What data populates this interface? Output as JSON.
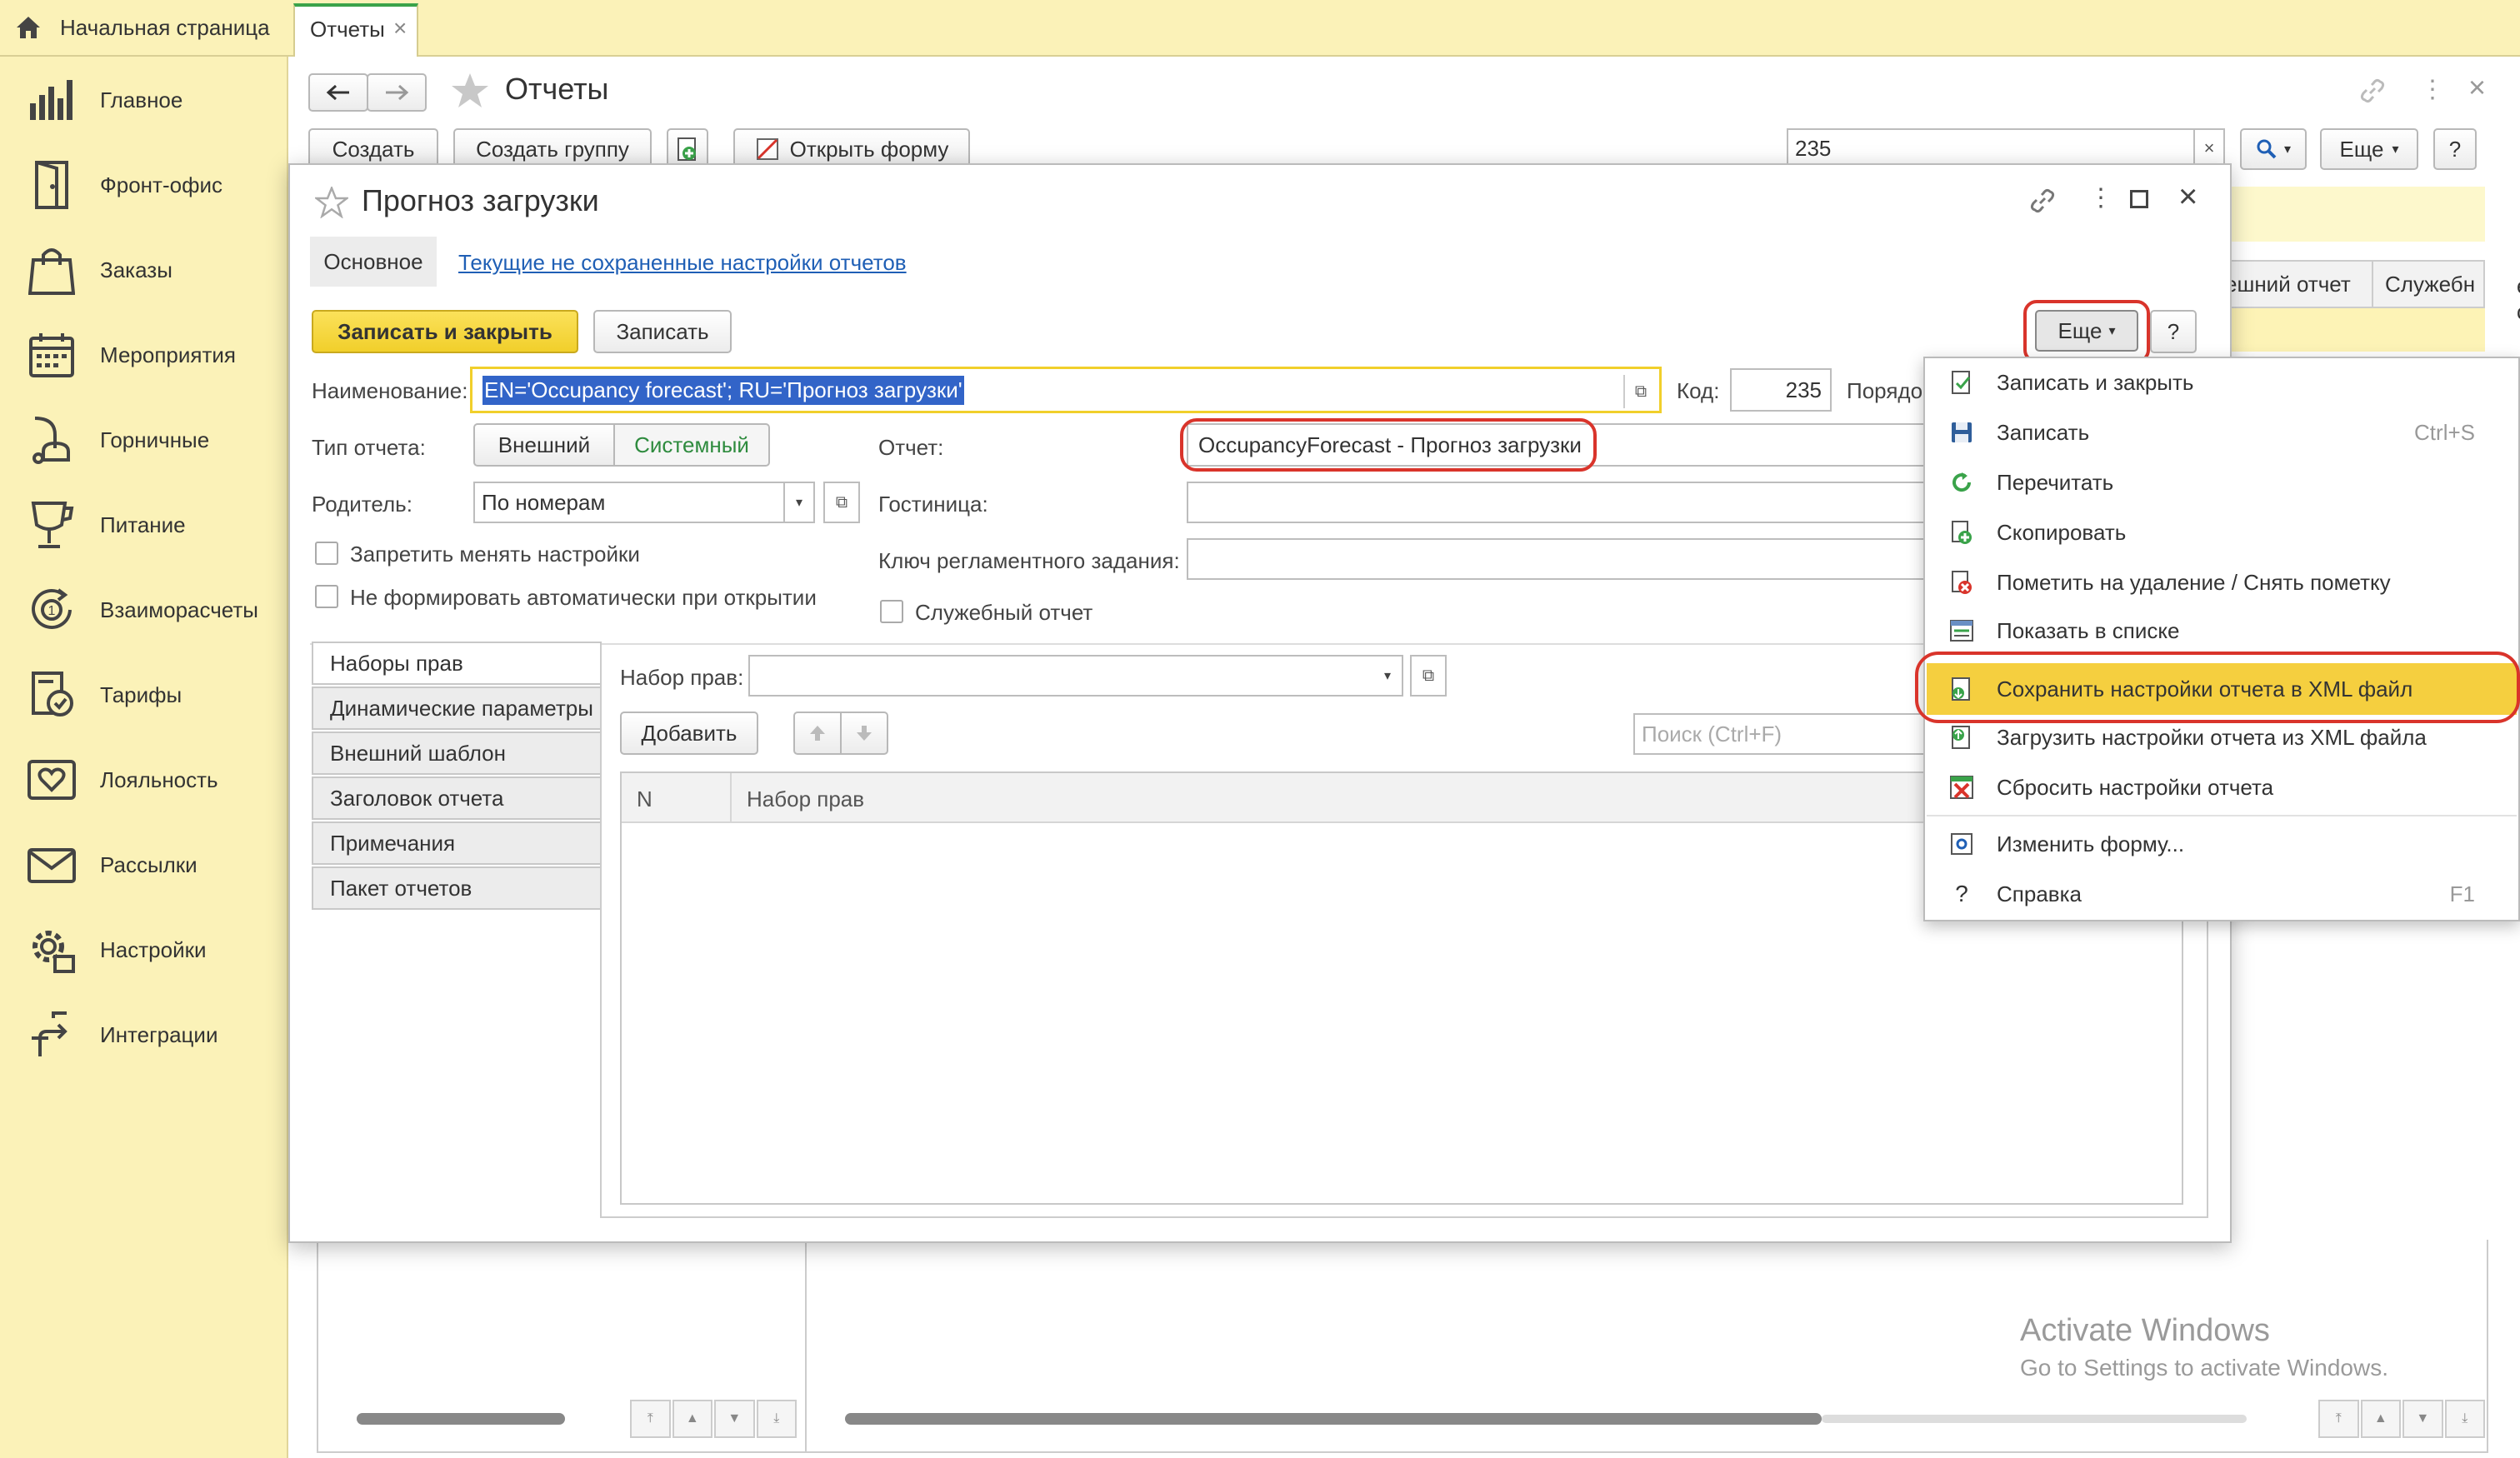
{
  "topbar": {
    "home_tab": "Начальная страница",
    "reports_tab": "Отчеты",
    "close": "×"
  },
  "sidebar": {
    "items": [
      {
        "label": "Главное",
        "icon": "bar-chart-icon"
      },
      {
        "label": "Фронт-офис",
        "icon": "door-icon"
      },
      {
        "label": "Заказы",
        "icon": "shopping-bag-icon"
      },
      {
        "label": "Мероприятия",
        "icon": "calendar-icon"
      },
      {
        "label": "Горничные",
        "icon": "vacuum-icon"
      },
      {
        "label": "Питание",
        "icon": "cup-icon"
      },
      {
        "label": "Взаиморасчеты",
        "icon": "coin-exchange-icon"
      },
      {
        "label": "Тарифы",
        "icon": "tariff-icon"
      },
      {
        "label": "Лояльность",
        "icon": "heart-envelope-icon"
      },
      {
        "label": "Рассылки",
        "icon": "mail-icon"
      },
      {
        "label": "Настройки",
        "icon": "gear-icon"
      },
      {
        "label": "Интеграции",
        "icon": "integration-icon"
      }
    ]
  },
  "reports_window": {
    "title": "Отчеты",
    "create": "Создать",
    "create_group": "Создать группу",
    "open_form": "Открыть форму",
    "search_value": "235",
    "more": "Еще",
    "help": "?",
    "col_external": "ешний отчет",
    "col_service": "Служебн"
  },
  "dialog": {
    "title": "Прогноз загрузки",
    "tab_main": "Основное",
    "tab_unsaved": "Текущие не сохраненные настройки отчетов",
    "save_close": "Записать и закрыть",
    "save": "Записать",
    "more": "Еще",
    "help": "?",
    "name_label": "Наименование:",
    "name_value": "EN='Occupancy forecast'; RU='Прогноз загрузки'",
    "code_label": "Код:",
    "code_value": "235",
    "order_label": "Порядо",
    "type_label": "Тип отчета:",
    "type_external": "Внешний",
    "type_system": "Системный",
    "report_label": "Отчет:",
    "report_value": "OccupancyForecast - Прогноз загрузки",
    "parent_label": "Родитель:",
    "parent_value": "По номерам",
    "hotel_label": "Гостиница:",
    "forbid_settings": "Запретить менять настройки",
    "no_autogen": "Не формировать автоматически при открытии",
    "schedule_key_label": "Ключ регламентного задания:",
    "service_report": "Служебный отчет",
    "vtabs": [
      "Наборы прав",
      "Динамические параметры",
      "Внешний шаблон",
      "Заголовок отчета",
      "Примечания",
      "Пакет отчетов"
    ],
    "rights_set_label": "Набор прав:",
    "add": "Добавить",
    "search_placeholder": "Поиск (Ctrl+F)",
    "table_col_n": "N",
    "table_col_rights": "Набор прав"
  },
  "context_menu": {
    "items": [
      {
        "label": "Записать и закрыть",
        "shortcut": "",
        "icon": "save-close-icon"
      },
      {
        "label": "Записать",
        "shortcut": "Ctrl+S",
        "icon": "floppy-icon"
      },
      {
        "label": "Перечитать",
        "shortcut": "",
        "icon": "refresh-icon"
      },
      {
        "label": "Скопировать",
        "shortcut": "",
        "icon": "copy-icon"
      },
      {
        "label": "Пометить на удаление / Снять пометку",
        "shortcut": "",
        "icon": "delete-mark-icon"
      },
      {
        "label": "Показать в списке",
        "shortcut": "",
        "icon": "list-icon"
      },
      {
        "label": "Сохранить настройки отчета в XML файл",
        "shortcut": "",
        "icon": "xml-save-icon"
      },
      {
        "label": "Загрузить настройки отчета из XML файла",
        "shortcut": "",
        "icon": "xml-load-icon"
      },
      {
        "label": "Сбросить настройки отчета",
        "shortcut": "",
        "icon": "reset-icon"
      },
      {
        "label": "Изменить форму...",
        "shortcut": "",
        "icon": "form-edit-icon"
      },
      {
        "label": "Справка",
        "shortcut": "F1",
        "icon": "help-icon"
      }
    ]
  },
  "watermark": {
    "line1": "Activate Windows",
    "line2": "Go to Settings to activate Windows."
  },
  "colors": {
    "accent_yellow": "#f5d93b",
    "sidebar_bg": "#fbf2b8",
    "highlight_red": "#d9342b",
    "link_blue": "#1f5fb5",
    "system_green": "#2e8b3e"
  }
}
